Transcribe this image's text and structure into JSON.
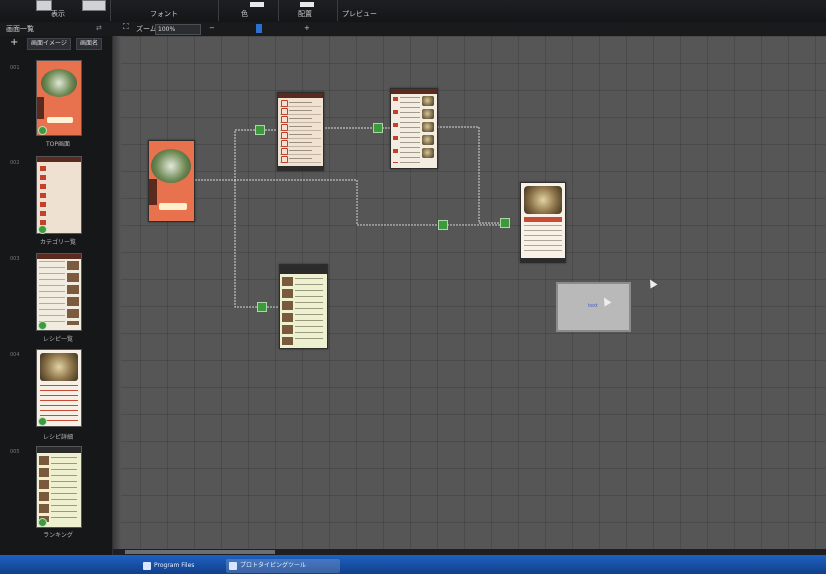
{
  "ribbon": {
    "groups": [
      {
        "label": "表示"
      },
      {
        "label": "フォント"
      },
      {
        "label": "色"
      },
      {
        "label": "配置"
      },
      {
        "label": "プレビュー"
      }
    ]
  },
  "subbar": {
    "panel_title": "画面一覧",
    "zoom_label": "ズーム",
    "zoom_value": "100%",
    "zoom_minus": "−",
    "zoom_plus": "+"
  },
  "panel": {
    "add_label": "+",
    "tabs": [
      "画面イメージ",
      "画面名"
    ],
    "pages": [
      {
        "num": "001",
        "name": "TOP画面"
      },
      {
        "num": "002",
        "name": "カテゴリー覧"
      },
      {
        "num": "003",
        "name": "レシピ一覧"
      },
      {
        "num": "004",
        "name": "レシピ詳細"
      },
      {
        "num": "005",
        "name": "ランキング"
      }
    ]
  },
  "canvas": {
    "note_text": "text"
  },
  "taskbar": {
    "items": [
      "Program Files",
      "プロトタイピングツール"
    ]
  },
  "colors": {
    "node_green": "#3c9a3c",
    "canvas_gray": "#565656",
    "taskbar_blue": "#1f61c2"
  }
}
